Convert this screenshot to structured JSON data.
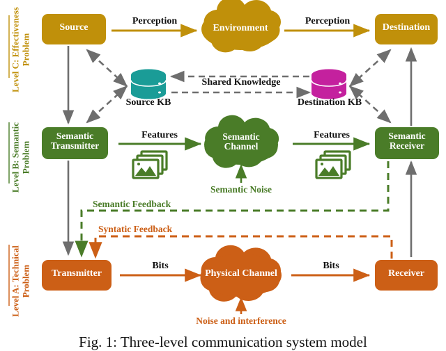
{
  "figure": {
    "caption": "Fig. 1: Three-level communication system model"
  },
  "colors": {
    "gold": "#C0900A",
    "green": "#4A7C28",
    "orange": "#CC5F16",
    "teal": "#1A9C97",
    "magenta": "#C4219E",
    "gray": "#6E6E6E",
    "black": "#111111",
    "white": "#FFFFFF"
  },
  "levels": [
    {
      "id": "level-c",
      "label": "Level C: Effectiveness\nProblem",
      "color": "#C0900A"
    },
    {
      "id": "level-b",
      "label": "Level B: Semantic\nProblem",
      "color": "#4A7C28"
    },
    {
      "id": "level-a",
      "label": "Level A: Technical\nProblem",
      "color": "#CC5F16"
    }
  ],
  "nodes": {
    "source": {
      "label": "Source",
      "shape": "rounded-box",
      "color": "#C0900A"
    },
    "environment": {
      "label": "Environment",
      "shape": "cloud",
      "color": "#C0900A"
    },
    "destination": {
      "label": "Destination",
      "shape": "rounded-box",
      "color": "#C0900A"
    },
    "source_kb": {
      "label": "Source KB",
      "shape": "database",
      "color": "#1A9C97"
    },
    "destination_kb": {
      "label": "Destination  KB",
      "shape": "database",
      "color": "#C4219E"
    },
    "semantic_transmitter": {
      "label": "Semantic\nTransmitter",
      "shape": "rounded-box",
      "color": "#4A7C28"
    },
    "semantic_channel": {
      "label": "Semantic\nChannel",
      "shape": "cloud",
      "color": "#4A7C28"
    },
    "semantic_receiver": {
      "label": "Semantic\nReceiver",
      "shape": "rounded-box",
      "color": "#4A7C28"
    },
    "transmitter": {
      "label": "Transmitter",
      "shape": "rounded-box",
      "color": "#CC5F16"
    },
    "physical_channel": {
      "label": "Physical  Channel",
      "shape": "cloud",
      "color": "#CC5F16"
    },
    "receiver": {
      "label": "Receiver",
      "shape": "rounded-box",
      "color": "#CC5F16"
    }
  },
  "edge_labels": {
    "perception_left": {
      "text": "Perception",
      "color": "#111111"
    },
    "perception_right": {
      "text": "Perception",
      "color": "#111111"
    },
    "shared_knowledge": {
      "text": "Shared Knowledge",
      "color": "#111111"
    },
    "features_left": {
      "text": "Features",
      "color": "#111111"
    },
    "features_right": {
      "text": "Features",
      "color": "#111111"
    },
    "semantic_noise": {
      "text": "Semantic Noise",
      "color": "#4A7C28"
    },
    "semantic_feedback": {
      "text": "Semantic Feedback",
      "color": "#4A7C28"
    },
    "syntatic_feedback": {
      "text": "Syntatic Feedback",
      "color": "#CC5F16"
    },
    "bits_left": {
      "text": "Bits",
      "color": "#111111"
    },
    "bits_right": {
      "text": "Bits",
      "color": "#111111"
    },
    "noise_interference": {
      "text": "Noise and interference",
      "color": "#CC5F16"
    }
  },
  "icons": {
    "features_left": "image-stack-icon",
    "features_right": "image-stack-icon",
    "source_kb": "database-icon",
    "destination_kb": "database-icon"
  }
}
